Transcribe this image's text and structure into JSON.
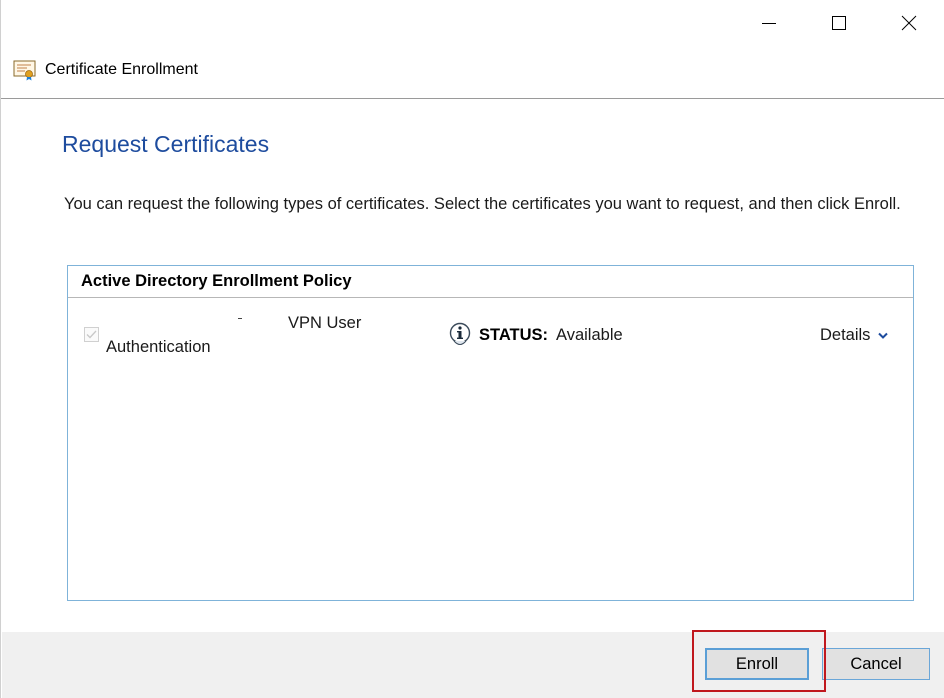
{
  "window": {
    "title": "Certificate Enrollment",
    "controls": [
      "minimize",
      "maximize",
      "close"
    ]
  },
  "page": {
    "heading": "Request Certificates",
    "intro": "You can request the following types of certificates. Select the certificates you want to request, and then click Enroll."
  },
  "policy": {
    "header": "Active Directory Enrollment Policy",
    "certificates": [
      {
        "name_line1": "VPN User",
        "name_line2": "Authentication",
        "checked": true,
        "status_label": "STATUS:",
        "status_value": "Available",
        "details_label": "Details"
      }
    ]
  },
  "footer": {
    "enroll_label": "Enroll",
    "cancel_label": "Cancel"
  },
  "colors": {
    "heading": "#1e4c9e",
    "highlight": "#c0181e",
    "list_border": "#7fb3d9",
    "focus_border": "#5b9fd6"
  },
  "icons": {
    "app": "certificate-icon",
    "status": "info-icon",
    "details": "chevron-down-icon"
  }
}
